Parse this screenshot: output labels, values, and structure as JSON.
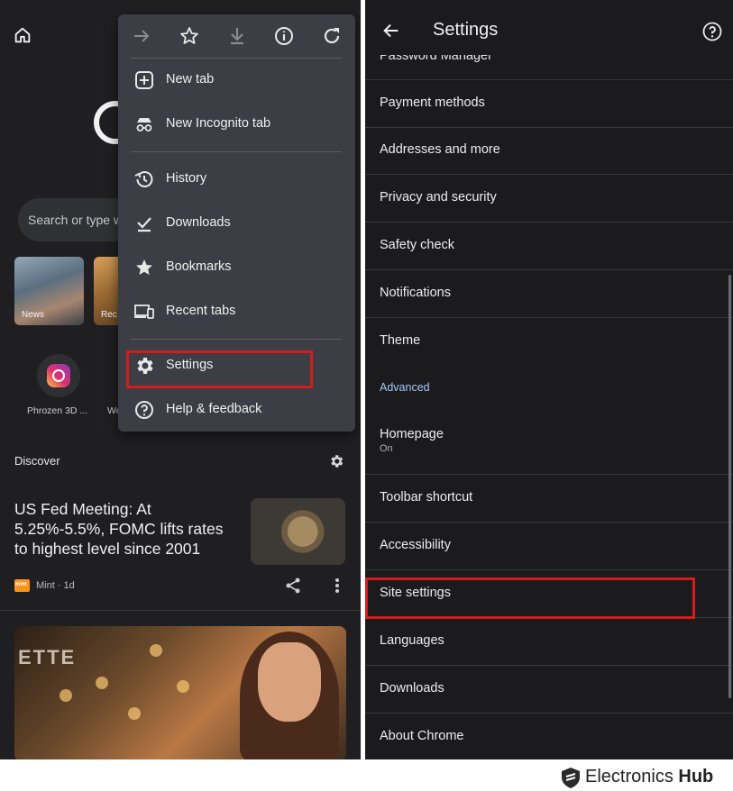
{
  "left_screen": {
    "search_placeholder": "Search or type w",
    "tiles": [
      {
        "label": "News"
      },
      {
        "label": "Rec"
      }
    ],
    "shortcuts": [
      {
        "label": "Phrozen 3D ..."
      },
      {
        "label": "We"
      }
    ],
    "discover_label": "Discover",
    "article": {
      "title": "US Fed Meeting: At 5.25%-5.5%, FOMC lifts rates to highest level since 2001",
      "source": "Mint · 1d",
      "source_logo_text": "mint"
    },
    "photo_sign": "ETTE"
  },
  "menu": {
    "toolbar_icons": [
      "forward-icon",
      "star-icon",
      "download-icon",
      "info-icon",
      "refresh-icon"
    ],
    "items": [
      {
        "label": "New tab",
        "icon": "plus-box-icon"
      },
      {
        "label": "New Incognito tab",
        "icon": "incognito-icon"
      },
      {
        "label": "History",
        "icon": "history-icon"
      },
      {
        "label": "Downloads",
        "icon": "download-done-icon"
      },
      {
        "label": "Bookmarks",
        "icon": "star-icon"
      },
      {
        "label": "Recent tabs",
        "icon": "devices-icon"
      },
      {
        "label": "Settings",
        "icon": "gear-icon"
      },
      {
        "label": "Help & feedback",
        "icon": "help-icon"
      }
    ]
  },
  "settings": {
    "title": "Settings",
    "cut_item": "Password Manager",
    "items": [
      {
        "label": "Payment methods"
      },
      {
        "label": "Addresses and more"
      },
      {
        "label": "Privacy and security"
      },
      {
        "label": "Safety check"
      },
      {
        "label": "Notifications"
      },
      {
        "label": "Theme"
      }
    ],
    "section_label": "Advanced",
    "advanced_items": [
      {
        "label": "Homepage",
        "sub": "On"
      },
      {
        "label": "Toolbar shortcut"
      },
      {
        "label": "Accessibility"
      },
      {
        "label": "Site settings"
      },
      {
        "label": "Languages"
      },
      {
        "label": "Downloads"
      },
      {
        "label": "About Chrome"
      }
    ]
  },
  "colors": {
    "highlight": "#d71a1a",
    "accent_blue": "#a8c7fa",
    "panel_bg": "#1f1f22",
    "menu_bg": "#3c3d45"
  },
  "watermark": {
    "brand_part1": "Electronics",
    "brand_part2": "Hub"
  }
}
